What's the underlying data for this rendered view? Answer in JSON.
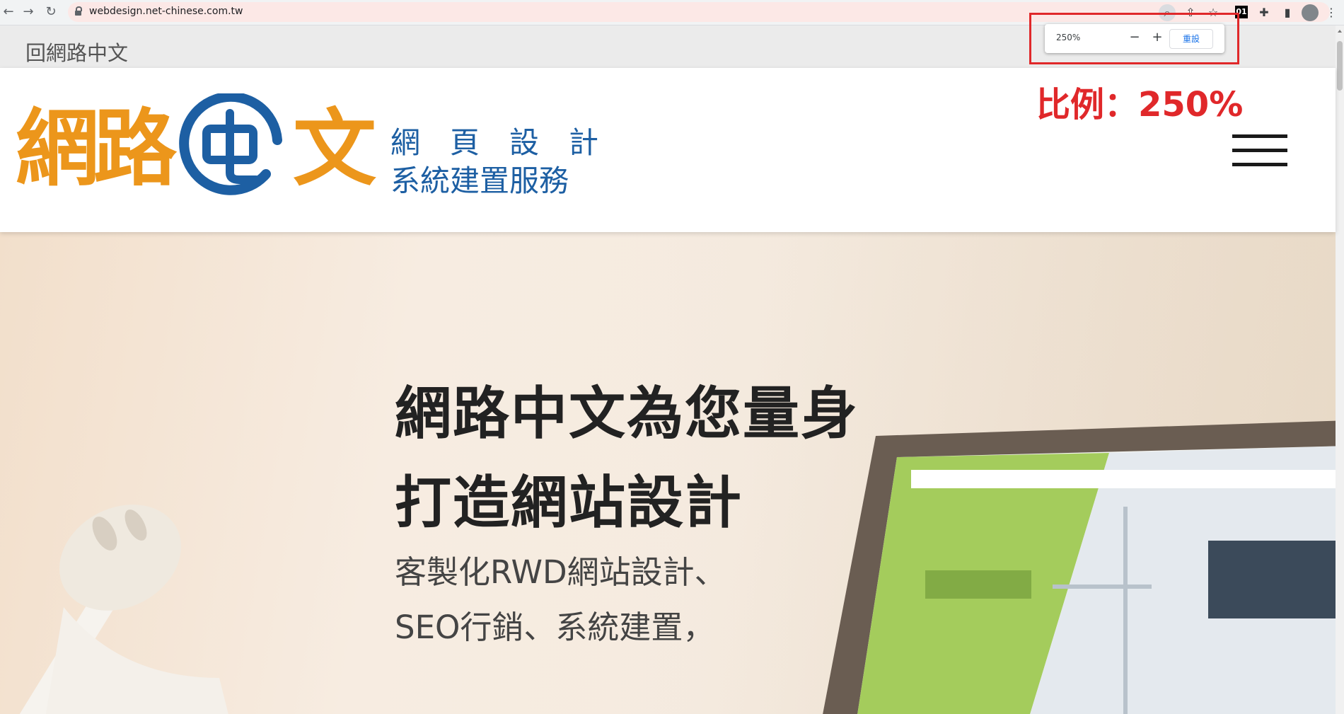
{
  "browser": {
    "url": "webdesign.net-chinese.com.tw",
    "zoom_popup": {
      "value": "250%",
      "reset_label": "重設",
      "minus": "−",
      "plus": "+"
    },
    "extension_badge": "01"
  },
  "annotation": {
    "label": "比例：250%"
  },
  "page": {
    "back_link": "回網路中文",
    "logo": {
      "chars": [
        "網",
        "路",
        "文"
      ],
      "tagline_line1": "網　頁　設　計",
      "tagline_line2": "系統建置服務"
    },
    "hero": {
      "title_line1": "網路中文為您量身",
      "title_line2": "打造網站設計",
      "sub_line1": "客製化RWD網站設計、",
      "sub_line2": "SEO行銷、系統建置，"
    }
  },
  "colors": {
    "logo_orange": "#ec961b",
    "logo_blue": "#1d5fa3",
    "annotation_red": "#e0282a",
    "zoom_reset_blue": "#1a73e8"
  }
}
